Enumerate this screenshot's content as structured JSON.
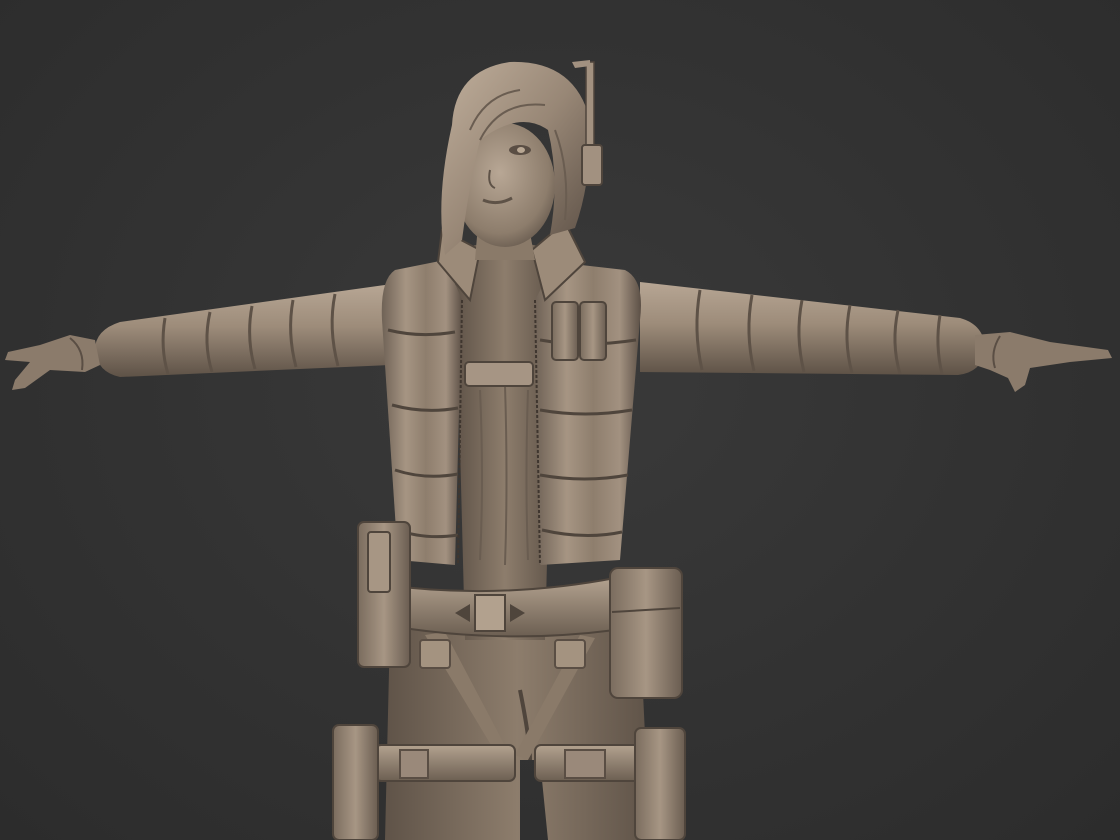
{
  "scene": {
    "background_color": "#323232",
    "clay_color": "#a09080",
    "clay_highlight": "#c9b8a5",
    "clay_shadow": "#4a4038",
    "subject": "clay-sculpt-character-t-pose"
  }
}
